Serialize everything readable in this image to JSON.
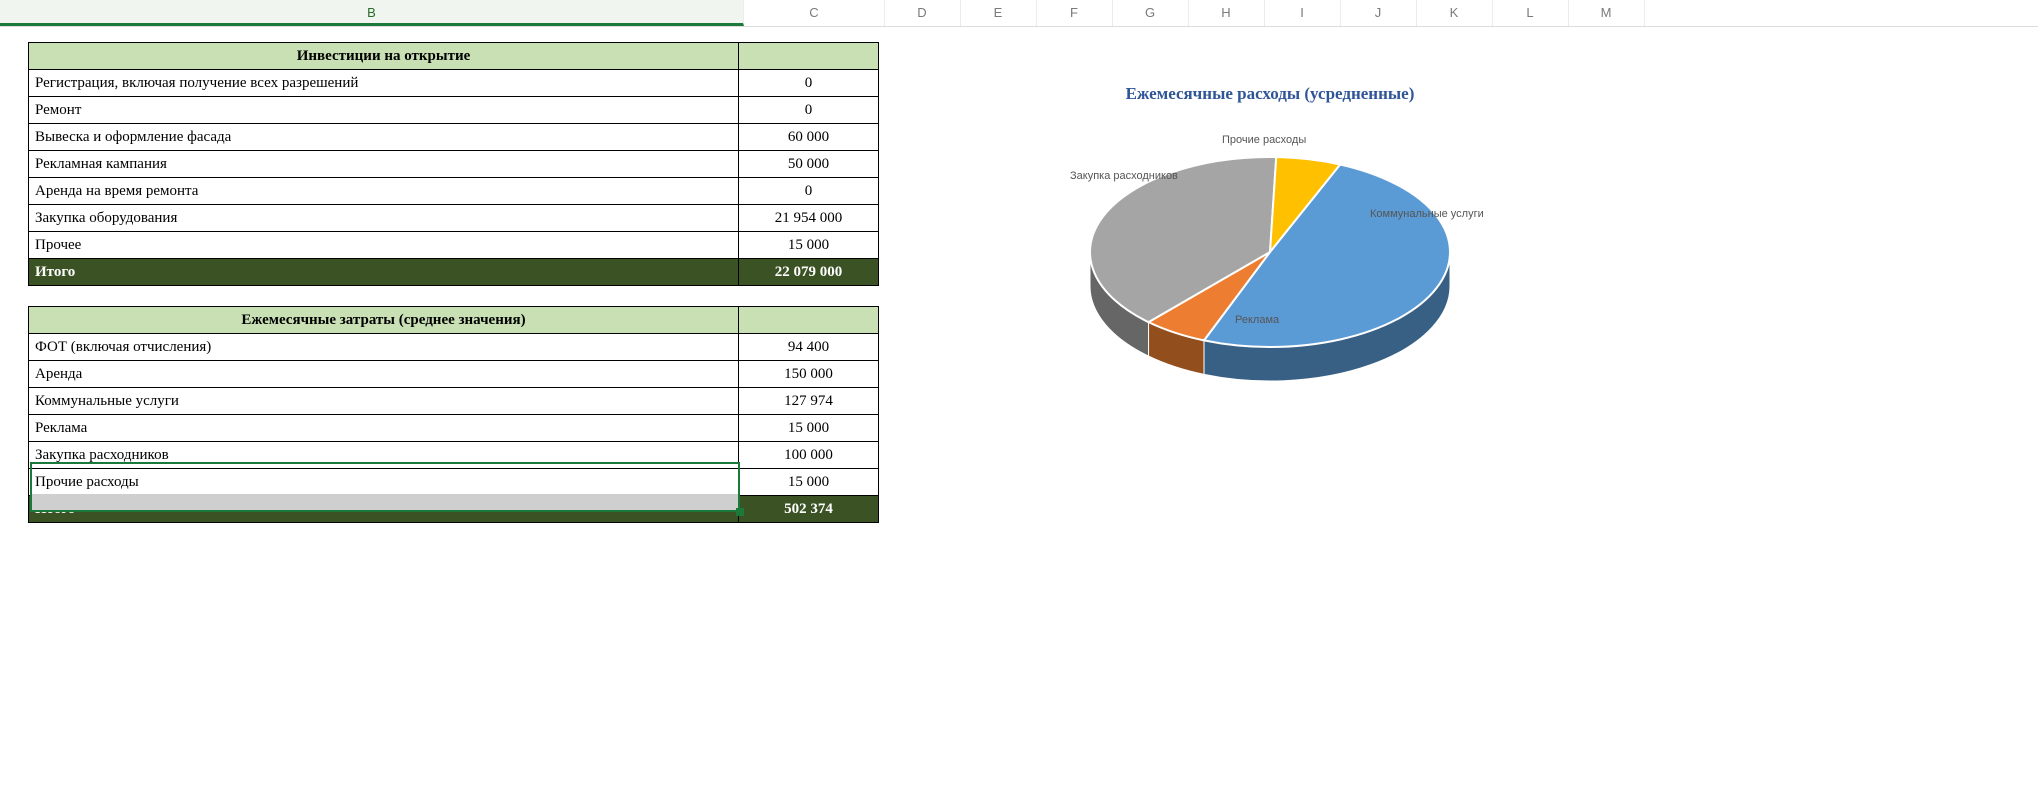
{
  "columns": [
    "B",
    "C",
    "D",
    "E",
    "F",
    "G",
    "H",
    "I",
    "J",
    "K",
    "L",
    "M"
  ],
  "active_column": "B",
  "table1": {
    "title": "Инвестиции на открытие",
    "rows": [
      {
        "label": "Регистрация, включая получение всех разрешений",
        "value": "0"
      },
      {
        "label": "Ремонт",
        "value": "0"
      },
      {
        "label": "Вывеска и оформление фасада",
        "value": "60 000"
      },
      {
        "label": "Рекламная кампания",
        "value": "50 000"
      },
      {
        "label": "Аренда на время ремонта",
        "value": "0"
      },
      {
        "label": "Закупка оборудования",
        "value": "21 954 000"
      },
      {
        "label": "Прочее",
        "value": "15 000"
      }
    ],
    "total_label": "Итого",
    "total_value": "22 079 000"
  },
  "table2": {
    "title": "Ежемесячные затраты (среднее значения)",
    "rows": [
      {
        "label": "ФОТ (включая отчисления)",
        "value": "94 400"
      },
      {
        "label": "Аренда",
        "value": "150 000"
      },
      {
        "label": "Коммунальные услуги",
        "value": "127 974"
      },
      {
        "label": "Реклама",
        "value": "15 000"
      },
      {
        "label": "Закупка расходников",
        "value": "100 000"
      },
      {
        "label": "Прочие расходы",
        "value": "15 000"
      }
    ],
    "total_label": "Итого",
    "total_value": "502 374"
  },
  "chart_data": {
    "type": "pie",
    "title": "Ежемесячные расходы (усредненные)",
    "series": [
      {
        "name": "Коммунальные услуги",
        "value": 127974,
        "color": "#5b9bd5"
      },
      {
        "name": "Реклама",
        "value": 15000,
        "color": "#ed7d31"
      },
      {
        "name": "Закупка расходников",
        "value": 100000,
        "color": "#a5a5a5"
      },
      {
        "name": "Прочие расходы",
        "value": 15000,
        "color": "#ffc000"
      }
    ]
  }
}
